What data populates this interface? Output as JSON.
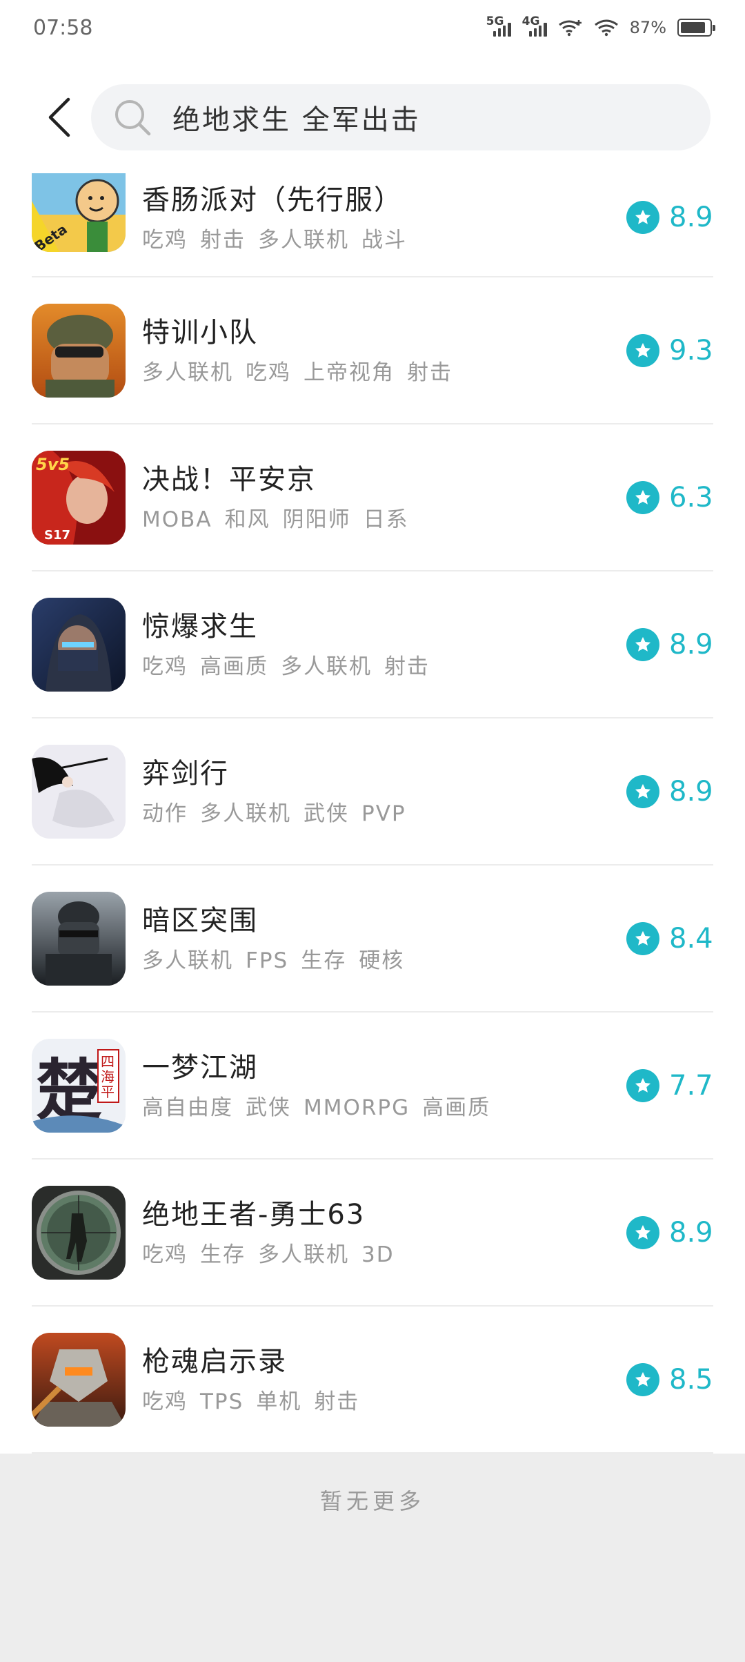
{
  "status_bar": {
    "time": "07:58",
    "net1": "5G",
    "net2": "4G",
    "battery": "87%",
    "battery_level": 0.87
  },
  "header": {
    "search_text": "绝地求生 全军出击"
  },
  "accent_color": "#1fb8c8",
  "games": [
    {
      "name": "香肠派对（先行服）",
      "tags": [
        "吃鸡",
        "射击",
        "多人联机",
        "战斗"
      ],
      "score": "8.9",
      "icon": "sausage-party-beta-icon"
    },
    {
      "name": "特训小队",
      "tags": [
        "多人联机",
        "吃鸡",
        "上帝视角",
        "射击"
      ],
      "score": "9.3",
      "icon": "soldier-helmet-icon"
    },
    {
      "name": "决战！平安京",
      "tags": [
        "MOBA",
        "和风",
        "阴阳师",
        "日系"
      ],
      "score": "6.3",
      "icon": "onmyoji-5v5-icon"
    },
    {
      "name": "惊爆求生",
      "tags": [
        "吃鸡",
        "高画质",
        "多人联机",
        "射击"
      ],
      "score": "8.9",
      "icon": "masked-soldier-icon"
    },
    {
      "name": "弈剑行",
      "tags": [
        "动作",
        "多人联机",
        "武侠",
        "PVP"
      ],
      "score": "8.9",
      "icon": "swordsman-ink-icon"
    },
    {
      "name": "暗区突围",
      "tags": [
        "多人联机",
        "FPS",
        "生存",
        "硬核"
      ],
      "score": "8.4",
      "icon": "tactical-soldier-icon"
    },
    {
      "name": "一梦江湖",
      "tags": [
        "高自由度",
        "武侠",
        "MMORPG",
        "高画质"
      ],
      "score": "7.7",
      "icon": "chu-calligraphy-icon"
    },
    {
      "name": "绝地王者-勇士63",
      "tags": [
        "吃鸡",
        "生存",
        "多人联机",
        "3D"
      ],
      "score": "8.9",
      "icon": "scope-soldier-icon"
    },
    {
      "name": "枪魂启示录",
      "tags": [
        "吃鸡",
        "TPS",
        "单机",
        "射击"
      ],
      "score": "8.5",
      "icon": "robot-armor-icon"
    }
  ],
  "footer": {
    "text": "暂无更多"
  }
}
